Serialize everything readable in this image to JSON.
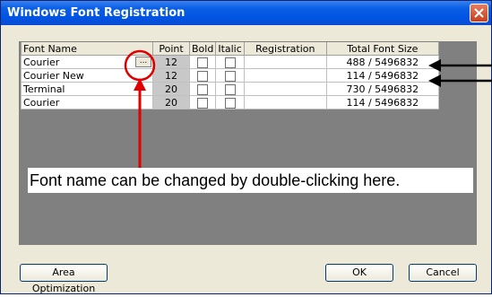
{
  "window": {
    "title": "Windows Font Registration"
  },
  "table": {
    "headers": {
      "font_name": "Font Name",
      "point": "Point",
      "bold": "Bold",
      "italic": "Italic",
      "registration": "Registration",
      "total": "Total Font Size"
    },
    "rows": [
      {
        "font_name": "Courier",
        "point": "12",
        "total": "488 / 5496832"
      },
      {
        "font_name": "Courier New",
        "point": "12",
        "total": "114 / 5496832"
      },
      {
        "font_name": "Terminal",
        "point": "20",
        "total": "730 / 5496832"
      },
      {
        "font_name": "Courier",
        "point": "20",
        "total": "114 / 5496832"
      }
    ],
    "ellipsis_label": "..."
  },
  "buttons": {
    "area_optimization": "Area Optimization",
    "ok": "OK",
    "cancel": "Cancel"
  },
  "annotation": {
    "callout_text": "Font name can be changed by double-clicking here."
  },
  "colors": {
    "titlebar": "#0054e3",
    "panel": "#808080",
    "callout": "#e00000",
    "dialog": "#ece9d8"
  }
}
